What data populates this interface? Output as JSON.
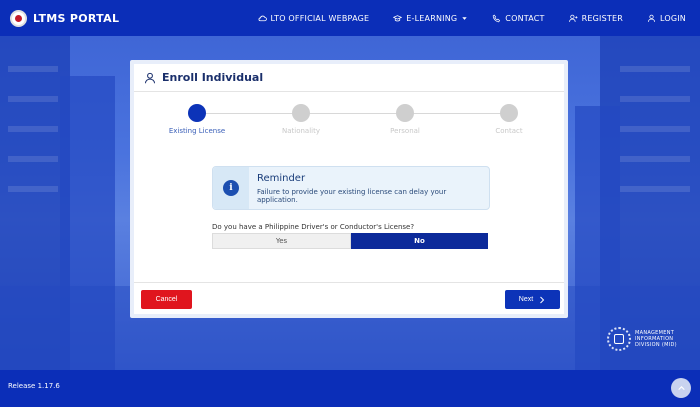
{
  "header": {
    "brand": "LTMS PORTAL",
    "nav": [
      {
        "label": "LTO OFFICIAL WEBPAGE",
        "icon": "cloud-icon"
      },
      {
        "label": "E-LEARNING",
        "icon": "graduation-cap-icon",
        "dropdown": true
      },
      {
        "label": "CONTACT",
        "icon": "phone-icon"
      },
      {
        "label": "REGISTER",
        "icon": "user-plus-icon"
      },
      {
        "label": "LOGIN",
        "icon": "user-icon"
      }
    ]
  },
  "card": {
    "title": "Enroll Individual",
    "steps": [
      {
        "label": "Existing License",
        "active": true
      },
      {
        "label": "Nationality",
        "active": false
      },
      {
        "label": "Personal",
        "active": false
      },
      {
        "label": "Contact",
        "active": false
      }
    ],
    "reminder": {
      "title": "Reminder",
      "body": "Failure to provide your existing license can delay your application."
    },
    "question": "Do you have a Philippine Driver's or Conductor's License?",
    "options": {
      "yes": "Yes",
      "no": "No",
      "selected": "No"
    },
    "cancel_label": "Cancel",
    "next_label": "Next"
  },
  "badge": {
    "line1": "MANAGEMENT",
    "line2": "INFORMATION",
    "line3": "DIVISION (MID)"
  },
  "footer": {
    "release": "Release 1.17.6"
  },
  "colors": {
    "primary": "#0c33b8",
    "danger": "#e0151e",
    "navbar": "#0b2eb8"
  }
}
